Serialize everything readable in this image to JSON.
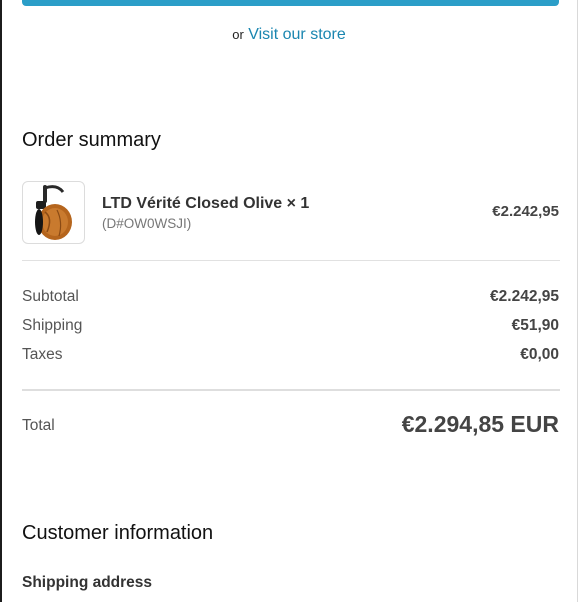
{
  "header": {
    "or_text": "or",
    "store_link": "Visit our store"
  },
  "order_summary": {
    "title": "Order summary",
    "item": {
      "name": "LTD Vérité Closed Olive × 1",
      "sku": "(D#OW0WSJI)",
      "price": "€2.242,95",
      "thumb_icon": "headphones-image"
    },
    "rows": [
      {
        "label": "Subtotal",
        "value": "€2.242,95"
      },
      {
        "label": "Shipping",
        "value": "€51,90"
      },
      {
        "label": "Taxes",
        "value": "€0,00"
      }
    ],
    "total": {
      "label": "Total",
      "value": "€2.294,85 EUR"
    }
  },
  "customer": {
    "title": "Customer information",
    "shipping_address_label": "Shipping address"
  },
  "colors": {
    "accent": "#2b9ec8",
    "link": "#1a86b0"
  }
}
